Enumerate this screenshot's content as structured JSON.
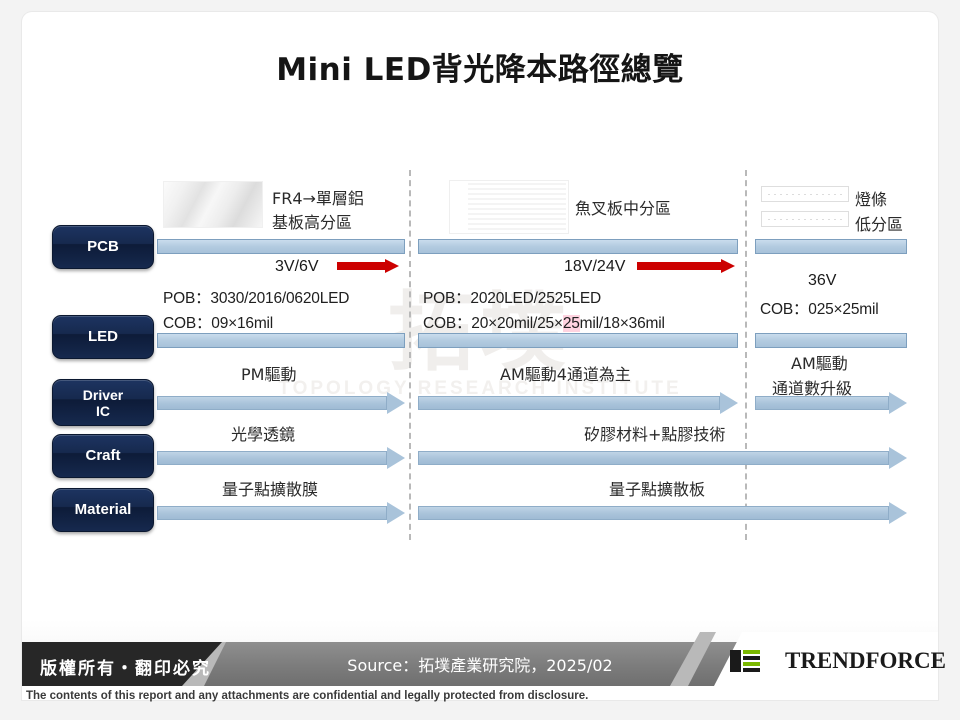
{
  "title": "Mini LED背光降本路徑總覽",
  "watermark": {
    "cjk": "拓墣",
    "en": "TOPOLOGY RESEARCH INSTITUTE"
  },
  "categories": [
    {
      "key": "pcb",
      "label": "PCB"
    },
    {
      "key": "led",
      "label": "LED"
    },
    {
      "key": "driver_ic",
      "label_line1": "Driver",
      "label_line2": "IC"
    },
    {
      "key": "craft",
      "label": "Craft"
    },
    {
      "key": "material",
      "label": "Material"
    }
  ],
  "columns": {
    "col1": {
      "pcb_caption_line1": "FR4→單層鋁",
      "pcb_caption_line2": "基板高分區",
      "voltage": "3V/6V",
      "led_pob": "POB：3030/2016/0620LED",
      "led_cob": "COB：09×16mil",
      "driver": "PM驅動",
      "craft": "光學透鏡",
      "material": "量子點擴散膜"
    },
    "col2": {
      "pcb_caption": "魚叉板中分區",
      "voltage": "18V/24V",
      "led_pob": "POB：2020LED/2525LED",
      "led_cob_a": "COB：20×20mil/25×",
      "led_cob_hl": "25",
      "led_cob_b": "mil/18×36mil",
      "driver": "AM驅動4通道為主",
      "craft": "矽膠材料+點膠技術",
      "material": "量子點擴散板"
    },
    "col3": {
      "pcb_caption_line1": "燈條",
      "pcb_caption_line2": "低分區",
      "voltage": "36V",
      "led_cob": "COB：025×25mil",
      "driver_line1": "AM驅動",
      "driver_line2": "通道數升級"
    }
  },
  "footer": {
    "copyright": "版權所有・翻印必究",
    "source": "Source：拓墣產業研究院，2025/02",
    "brand": "TRENDFORCE",
    "disclaimer": "The contents of this report and any attachments are confidential and legally protected from disclosure."
  },
  "colors": {
    "pill": "#16294e",
    "bar": "#a9c3da",
    "red_arrow": "#cc0000",
    "footer_dark": "#272727",
    "footer_gray": "#7d7d7d",
    "logo_green": "#7ab800"
  }
}
